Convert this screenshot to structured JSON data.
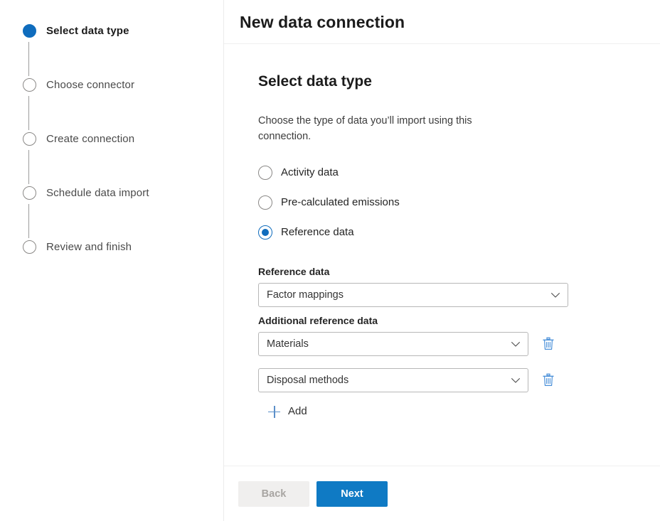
{
  "stepper": {
    "steps": [
      {
        "label": "Select data type",
        "state": "active"
      },
      {
        "label": "Choose connector",
        "state": "inactive"
      },
      {
        "label": "Create connection",
        "state": "inactive"
      },
      {
        "label": "Schedule data import",
        "state": "inactive"
      },
      {
        "label": "Review and finish",
        "state": "inactive"
      }
    ]
  },
  "header": {
    "title": "New data connection"
  },
  "main": {
    "section_title": "Select data type",
    "section_desc": "Choose the type of data you’ll import using this connection.",
    "radios": [
      {
        "label": "Activity data",
        "checked": false
      },
      {
        "label": "Pre-calculated emissions",
        "checked": false
      },
      {
        "label": "Reference data",
        "checked": true
      }
    ],
    "reference_data": {
      "label": "Factor mappings",
      "field_label": "Reference data"
    },
    "additional": {
      "field_label": "Additional reference data",
      "rows": [
        {
          "value": "Materials",
          "delete_icon": "trash-icon"
        },
        {
          "value": "Disposal methods",
          "delete_icon": "trash-icon"
        }
      ],
      "add_label": "Add",
      "add_icon": "plus-icon"
    }
  },
  "footer": {
    "back_label": "Back",
    "next_label": "Next"
  },
  "colors": {
    "accent": "#0f6cbd",
    "primary_button": "#0f7ac4",
    "icon_blue": "#4a90d9",
    "border": "#b7b7b7",
    "divider": "#f0f0f0",
    "disabled_text": "#a8a5a2"
  },
  "icons": {
    "chevron": "chevron-down-icon"
  }
}
